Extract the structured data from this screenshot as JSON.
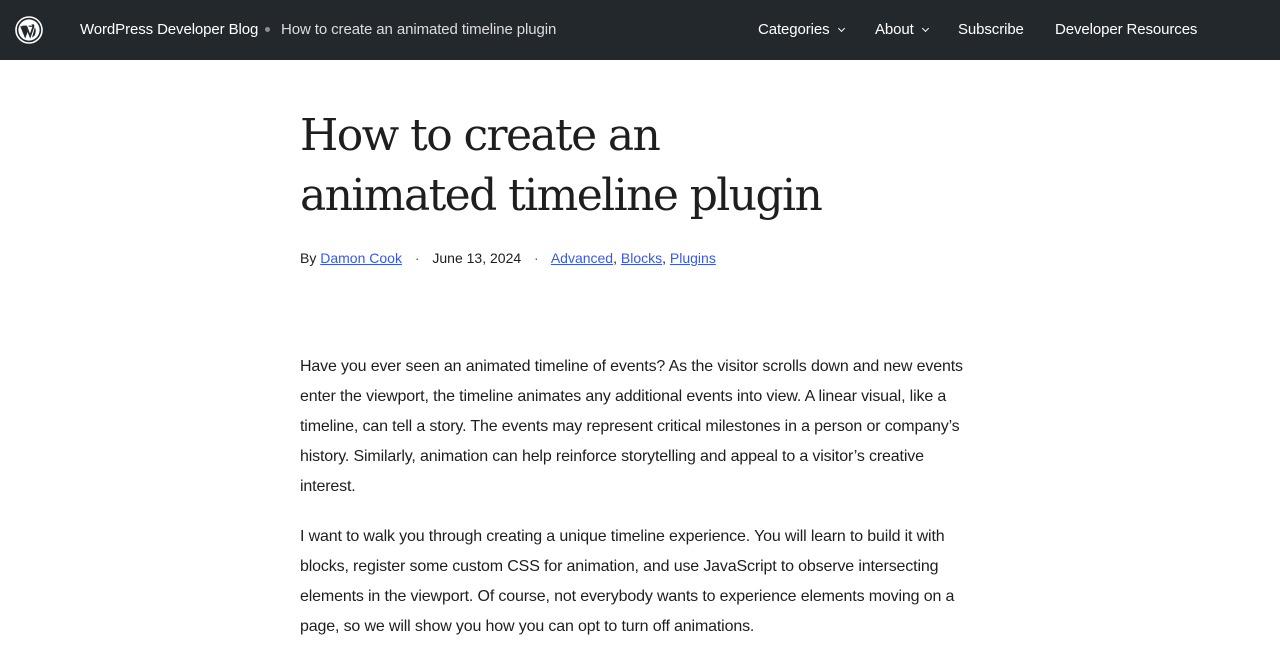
{
  "header": {
    "logo_icon": "wordpress-logo-icon",
    "site_title": "WordPress Developer Blog",
    "breadcrumb_separator_icon": "bullet-dot-icon",
    "breadcrumb_current": "How to create an animated timeline plugin",
    "nav": [
      {
        "label": "Categories",
        "has_dropdown": true,
        "icon": "chevron-down-icon"
      },
      {
        "label": "About",
        "has_dropdown": true,
        "icon": "chevron-down-icon"
      },
      {
        "label": "Subscribe",
        "has_dropdown": false
      },
      {
        "label": "Developer Resources",
        "has_dropdown": false
      }
    ],
    "background_color": "#23282d"
  },
  "post": {
    "title": "How to create an animated timeline plugin",
    "meta": {
      "by_label": "By",
      "author": "Damon Cook",
      "date": "June 13, 2024",
      "separator": "·",
      "categories": [
        "Advanced",
        "Blocks",
        "Plugins"
      ],
      "category_delimiter": ","
    },
    "link_color": "#3858e9",
    "paragraphs": [
      "Have you ever seen an animated timeline of events? As the visitor scrolls down and new events enter the viewport, the timeline animates any additional events into view. A linear visual, like a timeline, can tell a story. The events may represent critical milestones in a person or company’s history. Similarly, animation can help reinforce storytelling and appeal to a visitor’s creative interest.",
      "I want to walk you through creating a unique timeline experience. You will learn to build it with blocks, register some custom CSS for animation, and use JavaScript to observe intersecting elements in the viewport. Of course, not everybody wants to experience elements moving on a page, so we will show you how you can opt to turn off animations."
    ]
  }
}
